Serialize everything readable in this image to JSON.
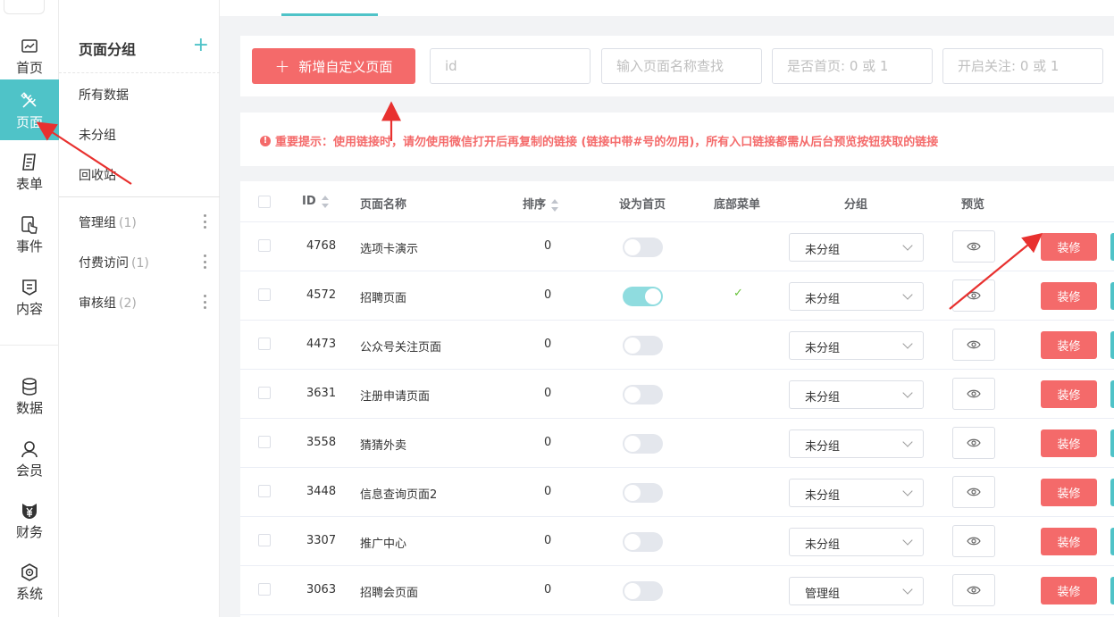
{
  "rail": {
    "items": [
      {
        "label": "首页",
        "icon": "chart-icon"
      },
      {
        "label": "页面",
        "icon": "tools-icon"
      },
      {
        "label": "表单",
        "icon": "form-icon"
      },
      {
        "label": "事件",
        "icon": "touch-icon"
      },
      {
        "label": "内容",
        "icon": "content-icon"
      },
      {
        "label": "数据",
        "icon": "database-icon"
      },
      {
        "label": "会员",
        "icon": "user-icon"
      },
      {
        "label": "财务",
        "icon": "yuan-shield-icon"
      },
      {
        "label": "系统",
        "icon": "settings-icon"
      }
    ],
    "active_index": 1
  },
  "groups": {
    "title": "页面分组",
    "add": "+",
    "static_items": [
      "所有数据",
      "未分组",
      "回收站"
    ],
    "custom": [
      {
        "name": "管理组",
        "count": "(1)"
      },
      {
        "name": "付费访问",
        "count": "(1)"
      },
      {
        "name": "审核组",
        "count": "(2)"
      }
    ]
  },
  "toolbar": {
    "add_label": "新增自定义页面",
    "add_plus": "+",
    "id_placeholder": "id",
    "name_placeholder": "输入页面名称查找",
    "home_placeholder": "是否首页: 0 或 1",
    "follow_placeholder": "开启关注: 0 或 1"
  },
  "notice": {
    "icon": "!",
    "text": "重要提示：使用链接时，请勿使用微信打开后再复制的链接 (链接中带#号的勿用)，所有入口链接都需从后台预览按钮获取的链接"
  },
  "table": {
    "headers": {
      "id": "ID",
      "name": "页面名称",
      "sort": "排序",
      "home": "设为首页",
      "bottom_menu": "底部菜单",
      "group": "分组",
      "preview": "预览"
    },
    "decorate_label": "装修",
    "check_mark": "✓",
    "rows": [
      {
        "id": "4768",
        "name": "选项卡演示",
        "sort": "0",
        "home": false,
        "bottom_menu": false,
        "group": "未分组"
      },
      {
        "id": "4572",
        "name": "招聘页面",
        "sort": "0",
        "home": true,
        "bottom_menu": true,
        "group": "未分组"
      },
      {
        "id": "4473",
        "name": "公众号关注页面",
        "sort": "0",
        "home": false,
        "bottom_menu": false,
        "group": "未分组"
      },
      {
        "id": "3631",
        "name": "注册申请页面",
        "sort": "0",
        "home": false,
        "bottom_menu": false,
        "group": "未分组"
      },
      {
        "id": "3558",
        "name": "猜猜外卖",
        "sort": "0",
        "home": false,
        "bottom_menu": false,
        "group": "未分组"
      },
      {
        "id": "3448",
        "name": "信息查询页面2",
        "sort": "0",
        "home": false,
        "bottom_menu": false,
        "group": "未分组"
      },
      {
        "id": "3307",
        "name": "推广中心",
        "sort": "0",
        "home": false,
        "bottom_menu": false,
        "group": "未分组"
      },
      {
        "id": "3063",
        "name": "招聘会页面",
        "sort": "0",
        "home": false,
        "bottom_menu": false,
        "group": "管理组"
      }
    ]
  },
  "colors": {
    "accent": "#4fc3c8",
    "danger": "#f46a6a",
    "arrow": "#e8312f"
  }
}
